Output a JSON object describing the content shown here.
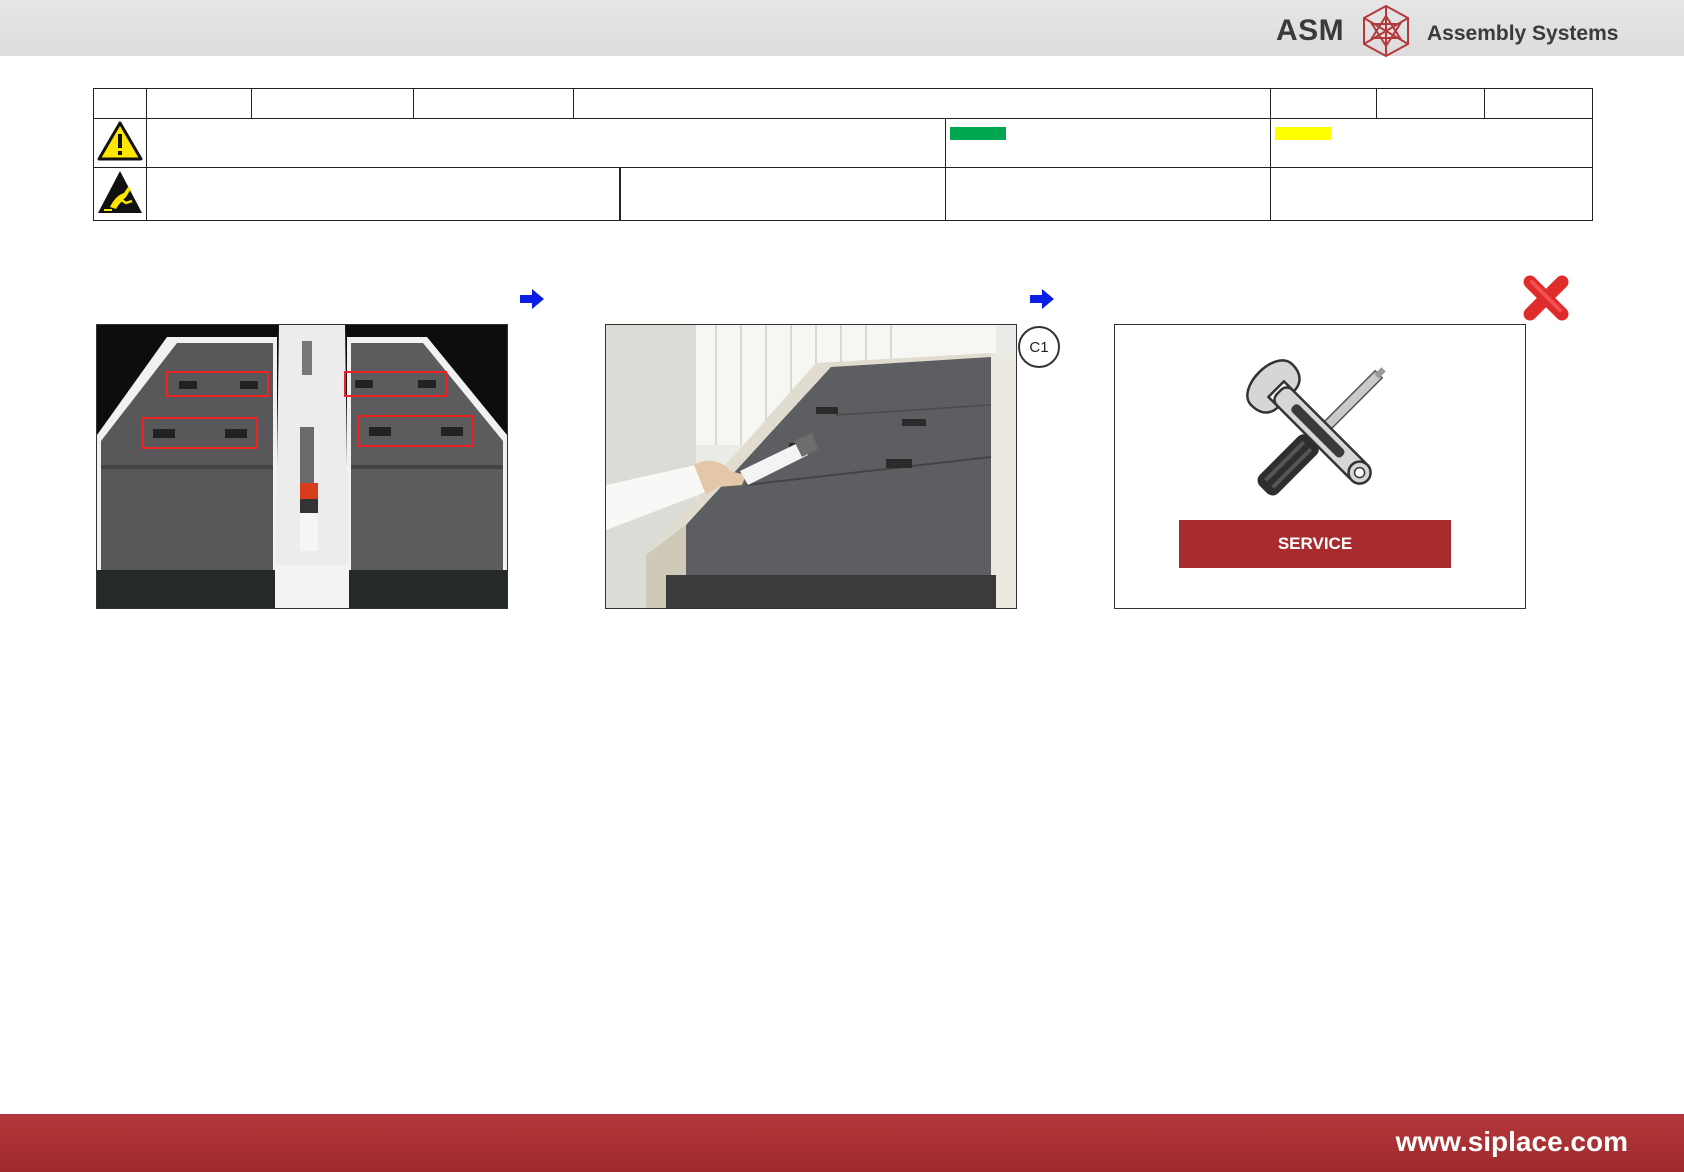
{
  "header": {
    "logo_asm": "ASM",
    "logo_text": "Assembly Systems"
  },
  "status_colors": {
    "green": "#00a650",
    "yellow": "#ffff00"
  },
  "icons": {
    "warning": "warning-triangle-icon",
    "esd": "esd-warning-icon",
    "arrow": "arrow-right-icon",
    "close": "close-x-icon",
    "service": "wrench-screwdriver-icon"
  },
  "steps": {
    "callout": "C1",
    "service_label": "SERVICE"
  },
  "footer": {
    "url": "www.siplace.com"
  }
}
